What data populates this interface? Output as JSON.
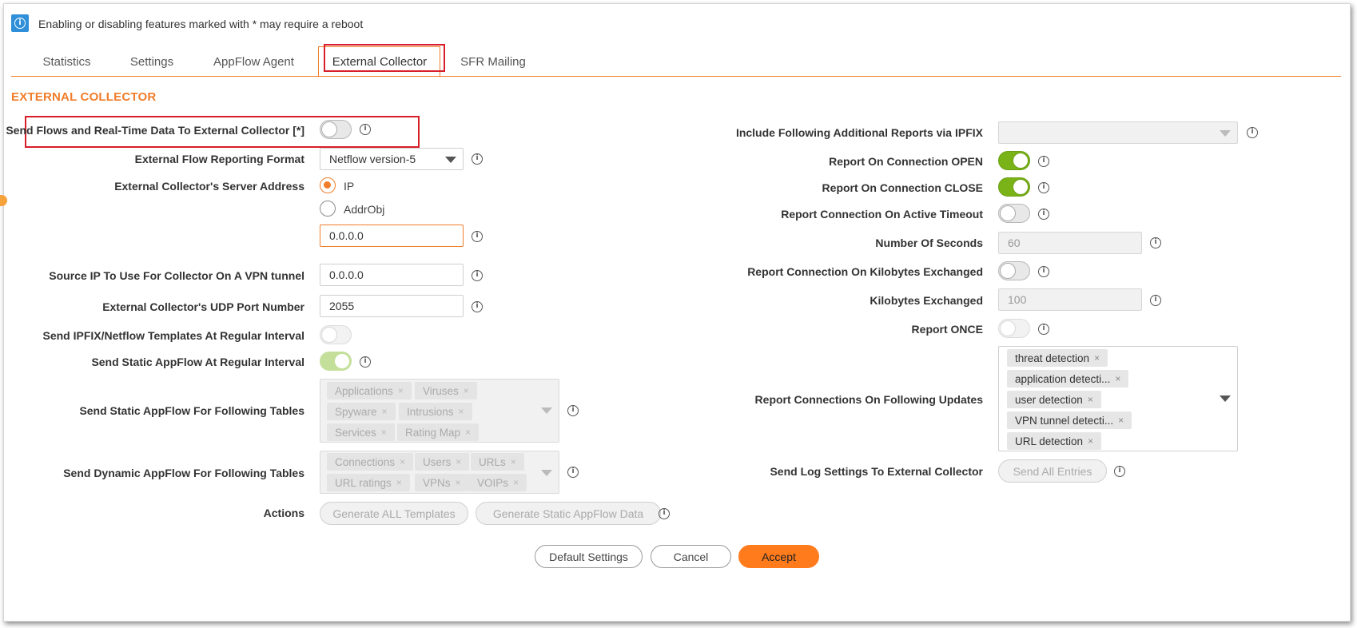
{
  "info_bar": {
    "icon": "info-icon",
    "text": "Enabling or disabling features marked with * may require a reboot"
  },
  "tabs": [
    {
      "label": "Statistics",
      "active": false
    },
    {
      "label": "Settings",
      "active": false
    },
    {
      "label": "AppFlow Agent",
      "active": false
    },
    {
      "label": "External Collector",
      "active": true
    },
    {
      "label": "SFR Mailing",
      "active": false
    }
  ],
  "section_title": "EXTERNAL COLLECTOR",
  "left": {
    "send_flows": {
      "label": "Send Flows and Real-Time Data To External Collector [*]",
      "enabled": false
    },
    "reporting_format": {
      "label": "External Flow Reporting Format",
      "value": "Netflow version-5"
    },
    "server_address": {
      "label": "External Collector's Server Address",
      "option_ip": "IP",
      "option_addrobj": "AddrObj",
      "selected": "IP",
      "value": "0.0.0.0"
    },
    "source_ip": {
      "label": "Source IP To Use For Collector On A VPN tunnel",
      "value": "0.0.0.0"
    },
    "udp_port": {
      "label": "External Collector's UDP Port Number",
      "value": "2055"
    },
    "send_templates": {
      "label": "Send IPFIX/Netflow Templates At Regular Interval",
      "enabled": false
    },
    "send_static": {
      "label": "Send Static AppFlow At Regular Interval",
      "enabled": true
    },
    "static_tables": {
      "label": "Send Static AppFlow For Following Tables",
      "chips": [
        "Applications",
        "Viruses",
        "Spyware",
        "Intrusions",
        "Services",
        "Rating Map"
      ]
    },
    "dynamic_tables": {
      "label": "Send Dynamic AppFlow For Following Tables",
      "chips": [
        "Connections",
        "Users",
        "URLs",
        "URL ratings",
        "VPNs",
        "VOIPs"
      ]
    },
    "actions": {
      "label": "Actions",
      "generate_all": "Generate ALL Templates",
      "generate_static": "Generate Static AppFlow Data"
    }
  },
  "right": {
    "additional_reports": {
      "label": "Include Following Additional Reports via IPFIX",
      "value": ""
    },
    "report_open": {
      "label": "Report On Connection OPEN",
      "enabled": true
    },
    "report_close": {
      "label": "Report On Connection CLOSE",
      "enabled": true
    },
    "report_timeout": {
      "label": "Report Connection On Active Timeout",
      "enabled": false
    },
    "num_seconds": {
      "label": "Number Of Seconds",
      "value": "60"
    },
    "report_kb": {
      "label": "Report Connection On Kilobytes Exchanged",
      "enabled": false
    },
    "kb_exchanged": {
      "label": "Kilobytes Exchanged",
      "value": "100"
    },
    "report_once": {
      "label": "Report ONCE",
      "enabled": false
    },
    "updates": {
      "label": "Report Connections On Following Updates",
      "chips": [
        "threat detection",
        "application detecti...",
        "user detection",
        "VPN tunnel detecti...",
        "URL detection"
      ]
    },
    "log_settings": {
      "label": "Send Log Settings To External Collector",
      "button": "Send All Entries"
    }
  },
  "footer": {
    "default_settings": "Default Settings",
    "cancel": "Cancel",
    "accept": "Accept"
  },
  "colors": {
    "accent": "#f07d2a",
    "toggle_on": "#7ab317",
    "highlight_box": "#d81e2a",
    "info_blue": "#2f8fd8"
  }
}
